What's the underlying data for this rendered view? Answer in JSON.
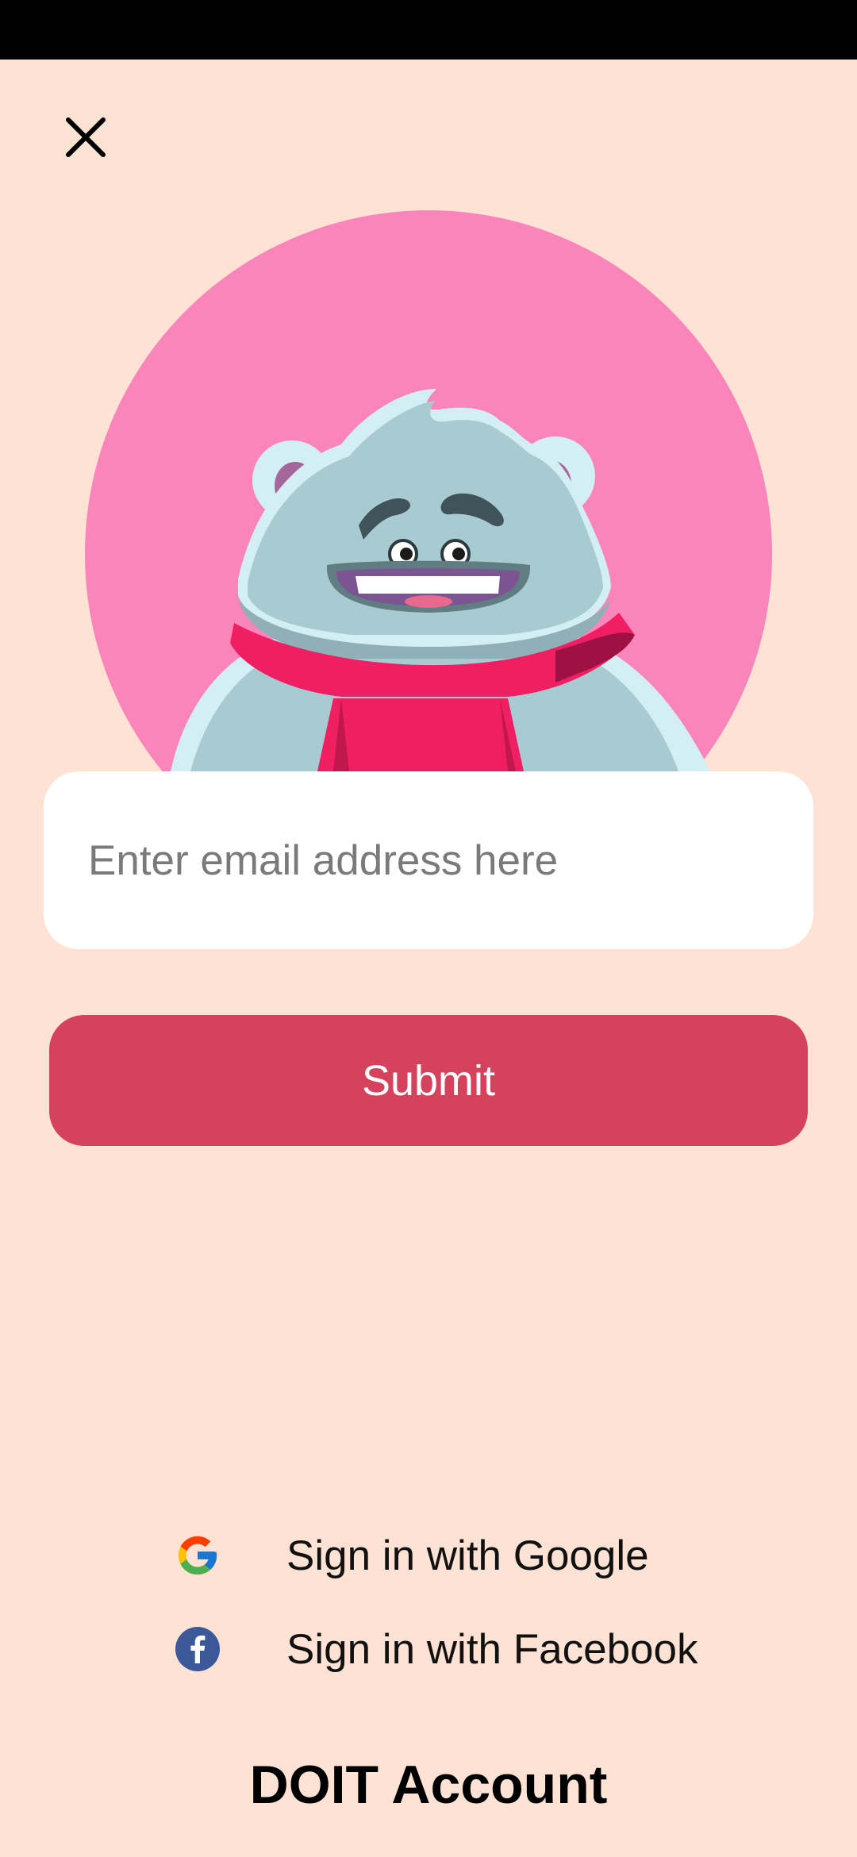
{
  "screen": {
    "background_color": "#FEE3D5",
    "status_bar_color": "#000000"
  },
  "close": {
    "icon": "close-icon"
  },
  "hero": {
    "circle_color": "#F985BA",
    "mascot": "bear-mascot-with-scarf"
  },
  "email": {
    "placeholder": "Enter email address here",
    "value": ""
  },
  "submit": {
    "label": "Submit",
    "color": "#D4425B"
  },
  "social": {
    "google": {
      "icon": "google-icon",
      "label": "Sign in with Google"
    },
    "facebook": {
      "icon": "facebook-icon",
      "label": "Sign in with Facebook",
      "color": "#3B5998"
    }
  },
  "footer": {
    "title": "DOIT Account"
  }
}
